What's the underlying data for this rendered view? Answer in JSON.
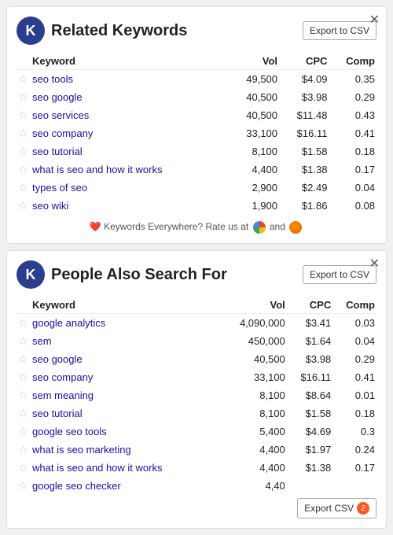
{
  "widget1": {
    "title": "Related Keywords",
    "export_label": "Export to CSV",
    "rate_text": "Keywords Everywhere? Rate us at",
    "rate_and": "and",
    "table": {
      "columns": [
        "",
        "Keyword",
        "Vol",
        "CPC",
        "Comp"
      ],
      "rows": [
        {
          "keyword": "seo tools",
          "vol": "49,500",
          "cpc": "$4.09",
          "comp": "0.35"
        },
        {
          "keyword": "seo google",
          "vol": "40,500",
          "cpc": "$3.98",
          "comp": "0.29"
        },
        {
          "keyword": "seo services",
          "vol": "40,500",
          "cpc": "$11.48",
          "comp": "0.43"
        },
        {
          "keyword": "seo company",
          "vol": "33,100",
          "cpc": "$16.11",
          "comp": "0.41"
        },
        {
          "keyword": "seo tutorial",
          "vol": "8,100",
          "cpc": "$1.58",
          "comp": "0.18"
        },
        {
          "keyword": "what is seo and how it works",
          "vol": "4,400",
          "cpc": "$1.38",
          "comp": "0.17"
        },
        {
          "keyword": "types of seo",
          "vol": "2,900",
          "cpc": "$2.49",
          "comp": "0.04"
        },
        {
          "keyword": "seo wiki",
          "vol": "1,900",
          "cpc": "$1.86",
          "comp": "0.08"
        }
      ]
    }
  },
  "widget2": {
    "title": "People Also Search For",
    "export_label": "Export to CSV",
    "export_badge": "2",
    "table": {
      "columns": [
        "",
        "Keyword",
        "Vol",
        "CPC",
        "Comp"
      ],
      "rows": [
        {
          "keyword": "google analytics",
          "vol": "4,090,000",
          "cpc": "$3.41",
          "comp": "0.03"
        },
        {
          "keyword": "sem",
          "vol": "450,000",
          "cpc": "$1.64",
          "comp": "0.04"
        },
        {
          "keyword": "seo google",
          "vol": "40,500",
          "cpc": "$3.98",
          "comp": "0.29"
        },
        {
          "keyword": "seo company",
          "vol": "33,100",
          "cpc": "$16.11",
          "comp": "0.41"
        },
        {
          "keyword": "sem meaning",
          "vol": "8,100",
          "cpc": "$8.64",
          "comp": "0.01"
        },
        {
          "keyword": "seo tutorial",
          "vol": "8,100",
          "cpc": "$1.58",
          "comp": "0.18"
        },
        {
          "keyword": "google seo tools",
          "vol": "5,400",
          "cpc": "$4.69",
          "comp": "0.3"
        },
        {
          "keyword": "what is seo marketing",
          "vol": "4,400",
          "cpc": "$1.97",
          "comp": "0.24"
        },
        {
          "keyword": "what is seo and how it works",
          "vol": "4,400",
          "cpc": "$1.38",
          "comp": "0.17"
        },
        {
          "keyword": "google seo checker",
          "vol": "4,40",
          "cpc": "",
          "comp": ""
        }
      ]
    }
  }
}
